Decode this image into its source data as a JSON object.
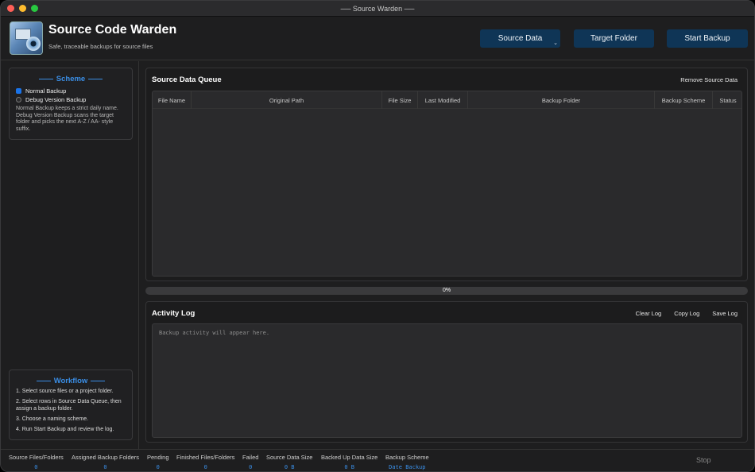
{
  "window": {
    "title": "── Source Warden ──"
  },
  "header": {
    "title": "Source Code Warden",
    "subtitle": "Safe, traceable backups for source files",
    "buttons": {
      "source": "Source Data",
      "target": "Target Folder",
      "start": "Start Backup"
    },
    "accent": "#0f3556"
  },
  "sidebar": {
    "scheme": {
      "title": "Scheme",
      "options": [
        {
          "label": "Normal Backup",
          "selected": true
        },
        {
          "label": "Debug Version Backup",
          "selected": false
        }
      ],
      "description": "Normal Backup keeps a strict daily name. Debug Version Backup scans the target folder and picks the next A-Z / AA- style suffix."
    },
    "workflow": {
      "title": "Workflow",
      "steps": [
        "1. Select source files or a project folder.",
        "2. Select rows in Source Data Queue, then assign a backup folder.",
        "3. Choose a naming scheme.",
        "4. Run Start Backup and review the log."
      ]
    }
  },
  "queue": {
    "title": "Source Data Queue",
    "remove_label": "Remove Source Data",
    "columns": [
      "File Name",
      "Original Path",
      "File Size",
      "Last Modified",
      "Backup Folder",
      "Backup Scheme",
      "Status"
    ],
    "rows": []
  },
  "progress": {
    "value": 0,
    "label": "0%"
  },
  "log": {
    "title": "Activity Log",
    "actions": {
      "clear": "Clear Log",
      "copy": "Copy Log",
      "save": "Save Log"
    },
    "placeholder": "Backup activity will appear here."
  },
  "status": {
    "items": [
      {
        "label": "Source Files/Folders",
        "value": "0"
      },
      {
        "label": "Assigned Backup Folders",
        "value": "0"
      },
      {
        "label": "Pending",
        "value": "0"
      },
      {
        "label": "Finished Files/Folders",
        "value": "0"
      },
      {
        "label": "Failed",
        "value": "0"
      },
      {
        "label": "Source Data Size",
        "value": "0 B"
      },
      {
        "label": "Backed Up Data Size",
        "value": "0 B"
      },
      {
        "label": "Backup Scheme",
        "value": "Date Backup"
      }
    ],
    "stop_label": "Stop"
  },
  "colors": {
    "accent_blue": "#3a8ee6",
    "selection_blue": "#1a73e8",
    "background": "#1e1e1f"
  }
}
